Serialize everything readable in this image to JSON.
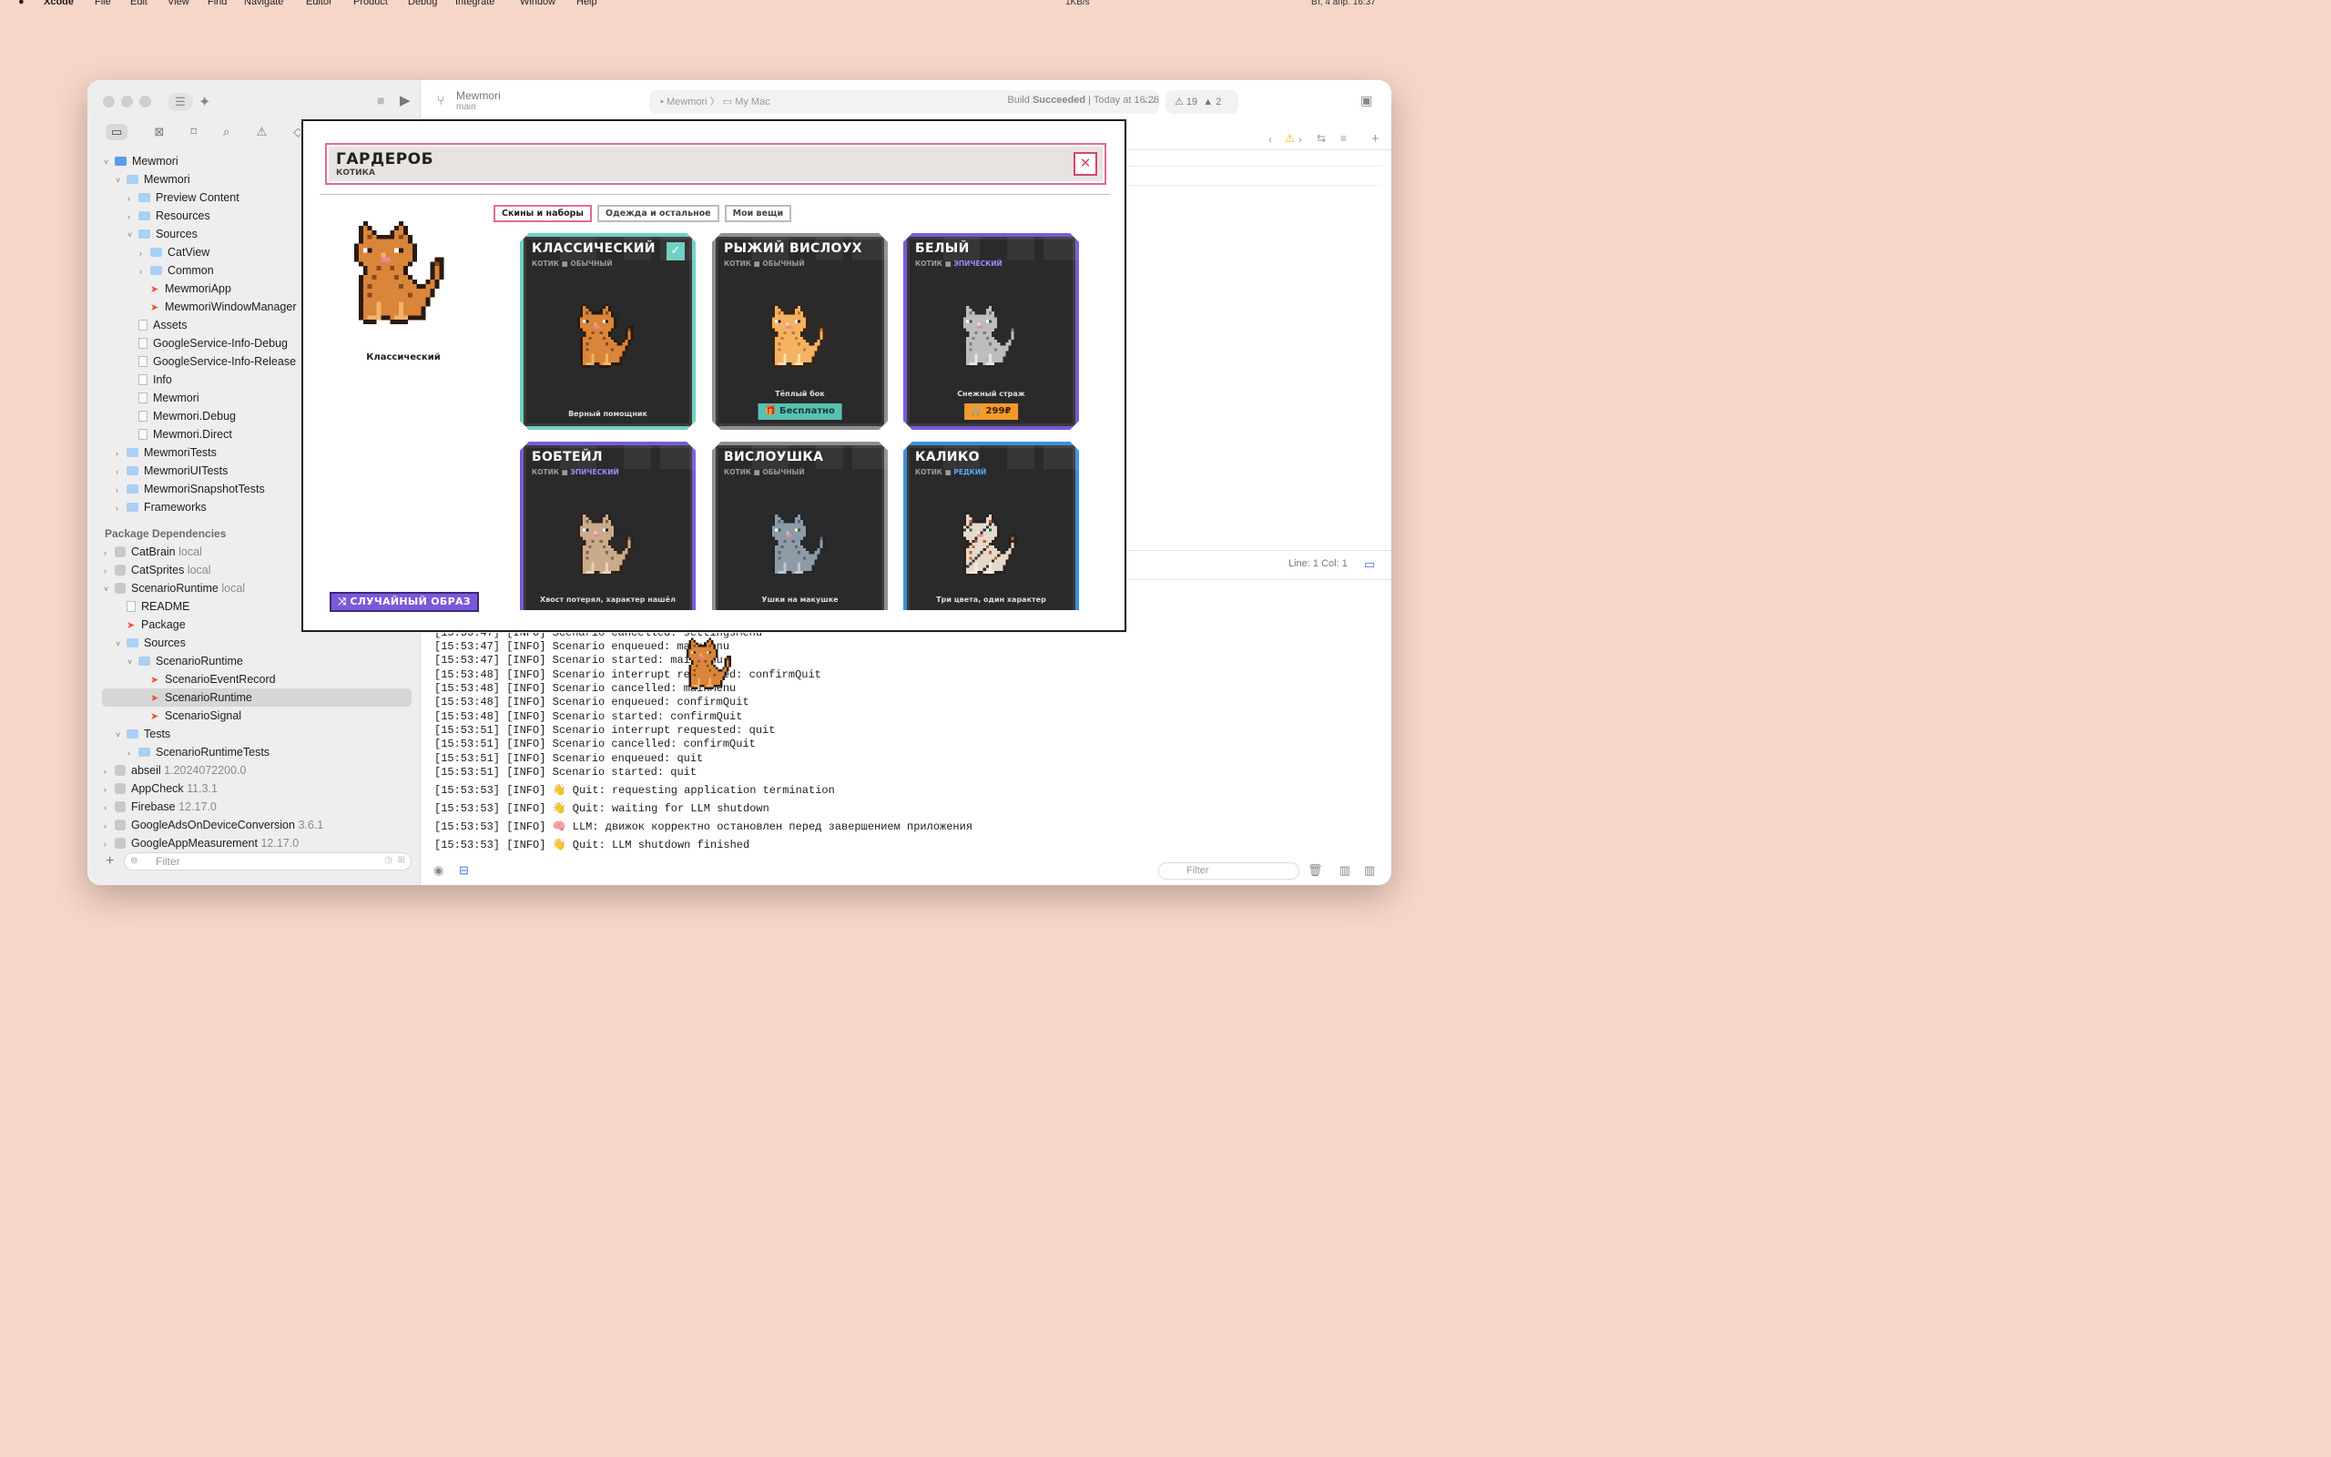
{
  "menubar": {
    "app": "Xcode",
    "items": [
      "File",
      "Edit",
      "View",
      "Find",
      "Navigate",
      "Editor",
      "Product",
      "Debug",
      "Integrate",
      "Window",
      "Help"
    ],
    "net": "1KB/s",
    "clock": "Вт, 4 апр. 16:37"
  },
  "toolbar": {
    "scheme": "Mewmori",
    "branch": "main",
    "crumb_project": "Mewmori",
    "crumb_sep": "〉",
    "crumb_dest": "My Mac",
    "build_prefix": "Build ",
    "build_status": "Succeeded",
    "build_time": " | Today at 16:26",
    "warnings": "19",
    "errors": "2"
  },
  "sidebar": {
    "items": [
      {
        "label": "Mewmori",
        "kind": "proj",
        "depth": 0,
        "chev": "˅",
        "sub": ""
      },
      {
        "label": "Mewmori",
        "kind": "folder",
        "depth": 1,
        "chev": "˅",
        "sub": ""
      },
      {
        "label": "Preview Content",
        "kind": "folder",
        "depth": 2,
        "chev": "›",
        "sub": ""
      },
      {
        "label": "Resources",
        "kind": "folder",
        "depth": 2,
        "chev": "›",
        "sub": ""
      },
      {
        "label": "Sources",
        "kind": "folder",
        "depth": 2,
        "chev": "˅",
        "sub": ""
      },
      {
        "label": "CatView",
        "kind": "folder",
        "depth": 3,
        "chev": "›",
        "sub": ""
      },
      {
        "label": "Common",
        "kind": "folder",
        "depth": 3,
        "chev": "›",
        "sub": ""
      },
      {
        "label": "MewmoriApp",
        "kind": "swift",
        "depth": 3,
        "chev": "",
        "sub": ""
      },
      {
        "label": "MewmoriWindowManager",
        "kind": "swift",
        "depth": 3,
        "chev": "",
        "sub": ""
      },
      {
        "label": "Assets",
        "kind": "file",
        "depth": 2,
        "chev": "",
        "sub": ""
      },
      {
        "label": "GoogleService-Info-Debug",
        "kind": "file",
        "depth": 2,
        "chev": "",
        "sub": ""
      },
      {
        "label": "GoogleService-Info-Release",
        "kind": "file",
        "depth": 2,
        "chev": "",
        "sub": ""
      },
      {
        "label": "Info",
        "kind": "file",
        "depth": 2,
        "chev": "",
        "sub": ""
      },
      {
        "label": "Mewmori",
        "kind": "file",
        "depth": 2,
        "chev": "",
        "sub": ""
      },
      {
        "label": "Mewmori.Debug",
        "kind": "file",
        "depth": 2,
        "chev": "",
        "sub": ""
      },
      {
        "label": "Mewmori.Direct",
        "kind": "file",
        "depth": 2,
        "chev": "",
        "sub": ""
      },
      {
        "label": "MewmoriTests",
        "kind": "folder",
        "depth": 1,
        "chev": "›",
        "sub": ""
      },
      {
        "label": "MewmoriUITests",
        "kind": "folder",
        "depth": 1,
        "chev": "›",
        "sub": ""
      },
      {
        "label": "MewmoriSnapshotTests",
        "kind": "folder",
        "depth": 1,
        "chev": "›",
        "sub": ""
      },
      {
        "label": "Frameworks",
        "kind": "folder",
        "depth": 1,
        "chev": "›",
        "sub": ""
      }
    ],
    "section": "Package Dependencies",
    "packages": [
      {
        "label": "CatBrain",
        "kind": "pkg",
        "depth": 0,
        "chev": "›",
        "sub": "local"
      },
      {
        "label": "CatSprites",
        "kind": "pkg",
        "depth": 0,
        "chev": "›",
        "sub": "local"
      },
      {
        "label": "ScenarioRuntime",
        "kind": "pkg",
        "depth": 0,
        "chev": "˅",
        "sub": "local"
      },
      {
        "label": "README",
        "kind": "file",
        "depth": 1,
        "chev": "",
        "sub": ""
      },
      {
        "label": "Package",
        "kind": "swift",
        "depth": 1,
        "chev": "",
        "sub": ""
      },
      {
        "label": "Sources",
        "kind": "folder",
        "depth": 1,
        "chev": "˅",
        "sub": ""
      },
      {
        "label": "ScenarioRuntime",
        "kind": "folder",
        "depth": 2,
        "chev": "˅",
        "sub": ""
      },
      {
        "label": "ScenarioEventRecord",
        "kind": "swift",
        "depth": 3,
        "chev": "",
        "sub": ""
      },
      {
        "label": "ScenarioRuntime",
        "kind": "swift",
        "depth": 3,
        "chev": "",
        "sub": "",
        "selected": true
      },
      {
        "label": "ScenarioSignal",
        "kind": "swift",
        "depth": 3,
        "chev": "",
        "sub": ""
      },
      {
        "label": "Tests",
        "kind": "folder",
        "depth": 1,
        "chev": "˅",
        "sub": ""
      },
      {
        "label": "ScenarioRuntimeTests",
        "kind": "folder",
        "depth": 2,
        "chev": "›",
        "sub": ""
      },
      {
        "label": "abseil",
        "kind": "pkg",
        "depth": 0,
        "chev": "›",
        "sub": "1.2024072200.0"
      },
      {
        "label": "AppCheck",
        "kind": "pkg",
        "depth": 0,
        "chev": "›",
        "sub": "11.3.1"
      },
      {
        "label": "Firebase",
        "kind": "pkg",
        "depth": 0,
        "chev": "›",
        "sub": "12.17.0"
      },
      {
        "label": "GoogleAdsOnDeviceConversion",
        "kind": "pkg",
        "depth": 0,
        "chev": "›",
        "sub": "3.6.1"
      },
      {
        "label": "GoogleAppMeasurement",
        "kind": "pkg",
        "depth": 0,
        "chev": "›",
        "sub": "12.17.0"
      }
    ],
    "filter_placeholder": "Filter"
  },
  "editor": {
    "position": "Line: 1  Col: 1",
    "console_filter": "Filter"
  },
  "console": [
    "[15:53:47] [INFO] Scenario cancelled: settingsMenu",
    "[15:53:47] [INFO] Scenario enqueued: mainMenu",
    "[15:53:47] [INFO] Scenario started: mainMenu",
    "[15:53:48] [INFO] Scenario interrupt requested: confirmQuit",
    "[15:53:48] [INFO] Scenario cancelled: mainMenu",
    "[15:53:48] [INFO] Scenario enqueued: confirmQuit",
    "[15:53:48] [INFO] Scenario started: confirmQuit",
    "[15:53:51] [INFO] Scenario interrupt requested: quit",
    "[15:53:51] [INFO] Scenario cancelled: confirmQuit",
    "[15:53:51] [INFO] Scenario enqueued: quit",
    "[15:53:51] [INFO] Scenario started: quit",
    "[15:53:53] [INFO] 👋 Quit: requesting application termination",
    "[15:53:53] [INFO] 👋 Quit: waiting for LLM shutdown",
    "[15:53:53] [INFO] 🧠 LLM: движок корректно остановлен перед завершением приложения",
    "[15:53:53] [INFO] 👋 Quit: LLM shutdown finished"
  ],
  "wardrobe": {
    "title": "ГАРДЕРОБ",
    "subtitle": "КОТИКА",
    "close": "✕",
    "tabs": [
      "Скины и наборы",
      "Одежда и остальное",
      "Мои вещи"
    ],
    "active_tab": 0,
    "selected_name": "Классический",
    "random_button": "СЛУЧАЙНЫЙ ОБРАЗ",
    "cards": [
      {
        "name": "КЛАССИЧЕСКИЙ",
        "type": "КОТИК",
        "rarity": "ОБЫЧНЫЙ",
        "desc": "Верный помощник",
        "border": "#6fd0c4",
        "owned": true,
        "price": "",
        "price_color": "",
        "palette": "orange"
      },
      {
        "name": "РЫЖИЙ ВИСЛОУХ",
        "type": "КОТИК",
        "rarity": "ОБЫЧНЫЙ",
        "desc": "Тёплый бок",
        "border": "#8f8f8f",
        "owned": false,
        "price": "Бесплатно",
        "price_color": "#58c1b3",
        "palette": "ginger"
      },
      {
        "name": "БЕЛЫЙ",
        "type": "КОТИК",
        "rarity": "ЭПИЧЕСКИЙ",
        "desc": "Снежный страж",
        "border": "#7a5ad8",
        "owned": false,
        "price": "299₽",
        "price_color": "#f39a2e",
        "palette": "grey"
      },
      {
        "name": "БОБТЕЙЛ",
        "type": "КОТИК",
        "rarity": "ЭПИЧЕСКИЙ",
        "desc": "Хвост потерял, характер нашёл",
        "border": "#7a5ad8",
        "owned": false,
        "price": "",
        "price_color": "",
        "palette": "beige"
      },
      {
        "name": "ВИСЛОУШКА",
        "type": "КОТИК",
        "rarity": "ОБЫЧНЫЙ",
        "desc": "Ушки на макушке",
        "border": "#8f8f8f",
        "owned": false,
        "price": "",
        "price_color": "",
        "palette": "blue"
      },
      {
        "name": "КАЛИКО",
        "type": "КОТИК",
        "rarity": "РЕДКИЙ",
        "desc": "Три цвета, один характер",
        "border": "#3d8fe0",
        "owned": false,
        "price": "",
        "price_color": "",
        "palette": "calico"
      }
    ]
  }
}
